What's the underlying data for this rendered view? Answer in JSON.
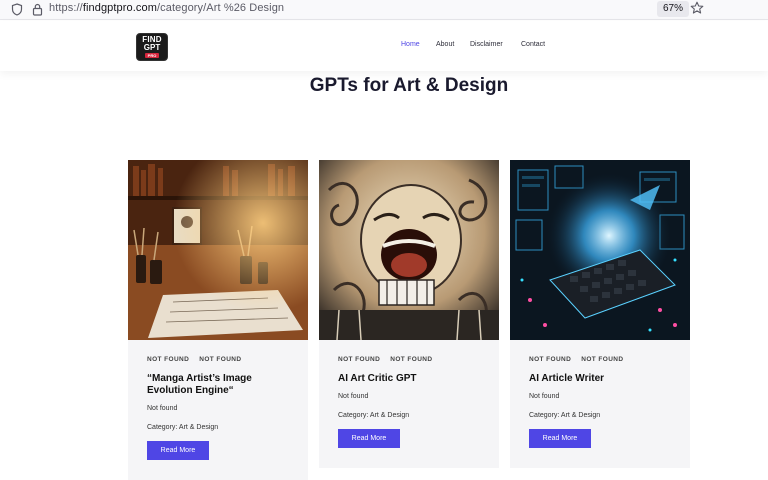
{
  "browser": {
    "url_prefix": "https://",
    "url_host": "findgptpro.com",
    "url_path": "/category/Art %26 Design",
    "zoom": "67%"
  },
  "site": {
    "logo": {
      "line1": "FIND",
      "line2": "GPT",
      "line3": "PRO"
    },
    "nav": [
      "Home",
      "About",
      "Disclaimer",
      "Contact"
    ]
  },
  "page": {
    "title": "GPTs for Art & Design"
  },
  "cards": [
    {
      "tag1": "NOT FOUND",
      "tag2": "NOT FOUND",
      "title": "“Manga Artist’s Image Evolution Engine“",
      "desc": "Not found",
      "category": "Category: Art & Design",
      "button": "Read More"
    },
    {
      "tag1": "NOT FOUND",
      "tag2": "NOT FOUND",
      "title": "AI Art Critic GPT",
      "desc": "Not found",
      "category": "Category: Art & Design",
      "button": "Read More"
    },
    {
      "tag1": "NOT FOUND",
      "tag2": "NOT FOUND",
      "title": "AI Article Writer",
      "desc": "Not found",
      "category": "Category: Art & Design",
      "button": "Read More"
    }
  ],
  "colors": {
    "accent": "#4f46e5",
    "card_bg": "#f5f5f7"
  },
  "icons": {
    "shield": "shield-icon",
    "lock": "lock-icon",
    "star": "star-icon"
  }
}
